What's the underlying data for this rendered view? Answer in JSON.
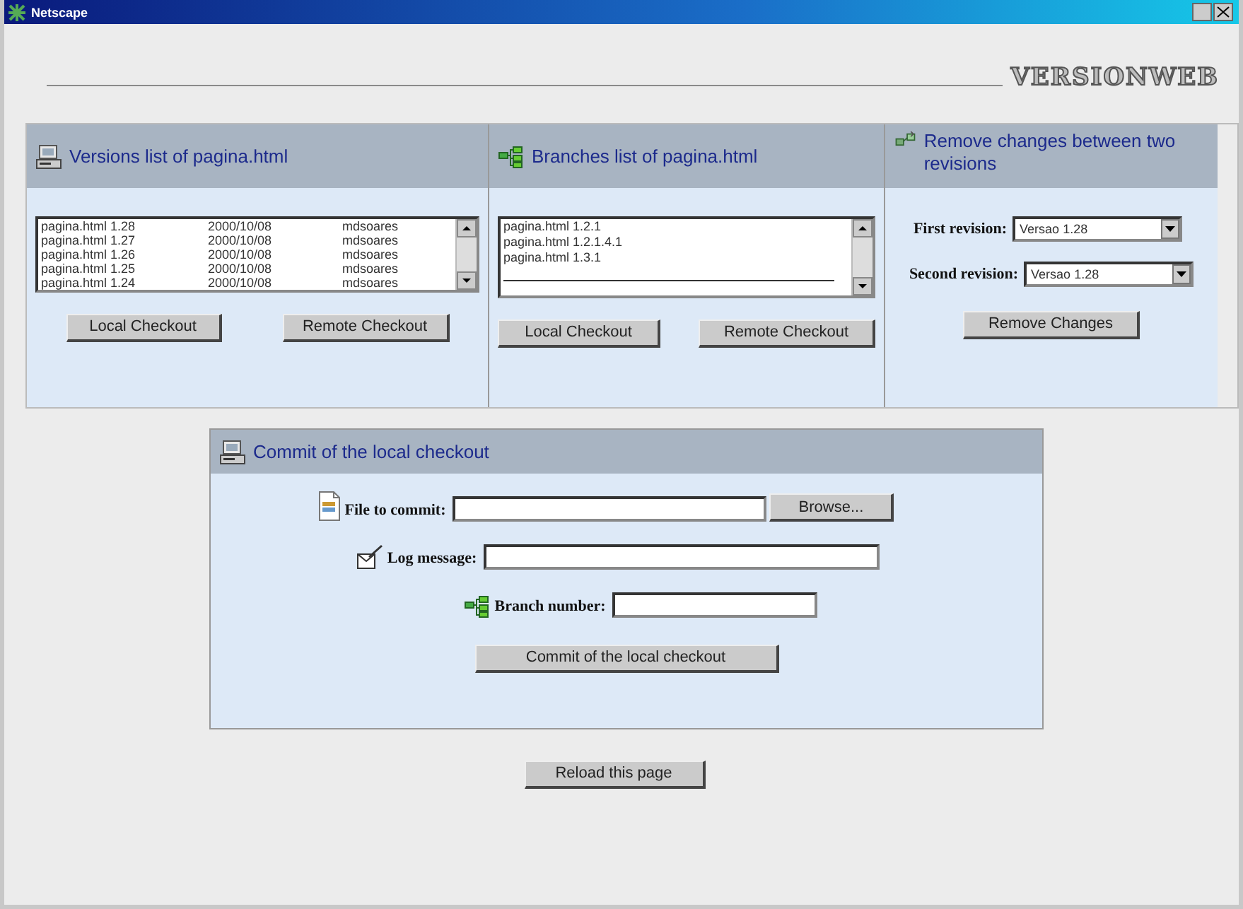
{
  "window": {
    "title": "Netscape"
  },
  "logo": "VERSIONWEB",
  "versions": {
    "title": "Versions list of pagina.html",
    "rows": [
      {
        "file": "pagina.html 1.28",
        "date": "2000/10/08",
        "author": "mdsoares"
      },
      {
        "file": "pagina.html 1.27",
        "date": "2000/10/08",
        "author": "mdsoares"
      },
      {
        "file": "pagina.html 1.26",
        "date": "2000/10/08",
        "author": "mdsoares"
      },
      {
        "file": "pagina.html 1.25",
        "date": "2000/10/08",
        "author": "mdsoares"
      },
      {
        "file": "pagina.html 1.24",
        "date": "2000/10/08",
        "author": "mdsoares"
      }
    ],
    "buttons": [
      "Local Checkout",
      "Remote Checkout"
    ]
  },
  "branches": {
    "title": "Branches list of pagina.html",
    "items": [
      "pagina.html 1.2.1",
      "pagina.html 1.2.1.4.1",
      "pagina.html 1.3.1"
    ],
    "buttons": [
      "Local Checkout",
      "Remote Checkout"
    ]
  },
  "remove": {
    "title": "Remove changes between two revisions",
    "fields": [
      {
        "label": "First revision:",
        "value": "Versao 1.28"
      },
      {
        "label": "Second revision:",
        "value": "Versao 1.28"
      }
    ],
    "button": "Remove Changes"
  },
  "commit": {
    "title": "Commit of the local checkout",
    "fields": [
      {
        "kind": "file",
        "label": "File to commit:",
        "browse": "Browse..."
      },
      {
        "kind": "log",
        "label": "Log message:"
      },
      {
        "kind": "branch",
        "label": "Branch number:"
      }
    ],
    "button": "Commit of the local checkout"
  },
  "reload": "Reload this page"
}
